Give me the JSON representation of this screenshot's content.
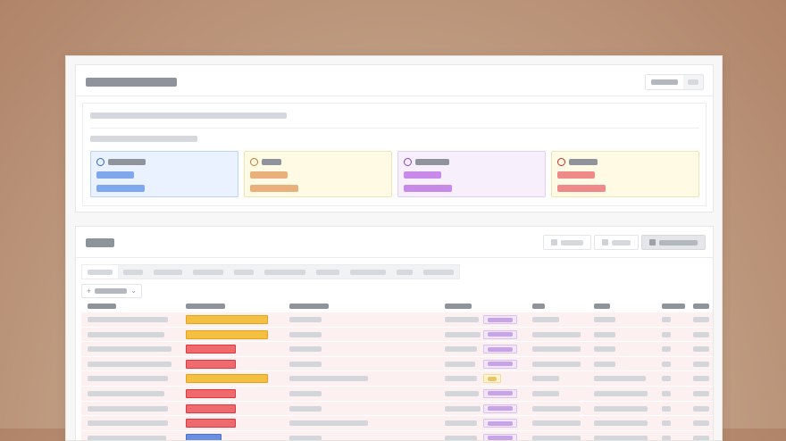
{
  "theme": {
    "tile_colors": [
      {
        "bg": "#e9f2fe",
        "border": "#bcd3f5",
        "circle": "#2f63c9",
        "v": "#7fa7ee"
      },
      {
        "bg": "#fefae3",
        "border": "#f1e6b3",
        "circle": "#c7762a",
        "v": "#e9b07c"
      },
      {
        "bg": "#f8effd",
        "border": "#e3cdf3",
        "circle": "#8a3fc2",
        "v": "#c78ae9"
      },
      {
        "bg": "#fefae3",
        "border": "#f1e6b3",
        "circle": "#c82c2c",
        "v": "#ee8a8a"
      }
    ]
  },
  "icons": {
    "tile_status": "circle-outline-icon",
    "view_button": "square-icon",
    "add": "plus-icon",
    "add_dropdown": "chevron-down-icon"
  },
  "add_button": {
    "plus": "+",
    "chevron": "⌄"
  },
  "table": {
    "rows": [
      {
        "status": "amber",
        "tag": "purple"
      },
      {
        "status": "amber",
        "tag": "purple"
      },
      {
        "status": "red",
        "tag": "purple"
      },
      {
        "status": "red",
        "tag": "purple"
      },
      {
        "status": "amber",
        "tag": "yellow"
      },
      {
        "status": "red",
        "tag": "purple"
      },
      {
        "status": "red",
        "tag": "purple"
      },
      {
        "status": "red",
        "tag": "purple"
      },
      {
        "status": "blue",
        "tag": "purple"
      }
    ]
  }
}
